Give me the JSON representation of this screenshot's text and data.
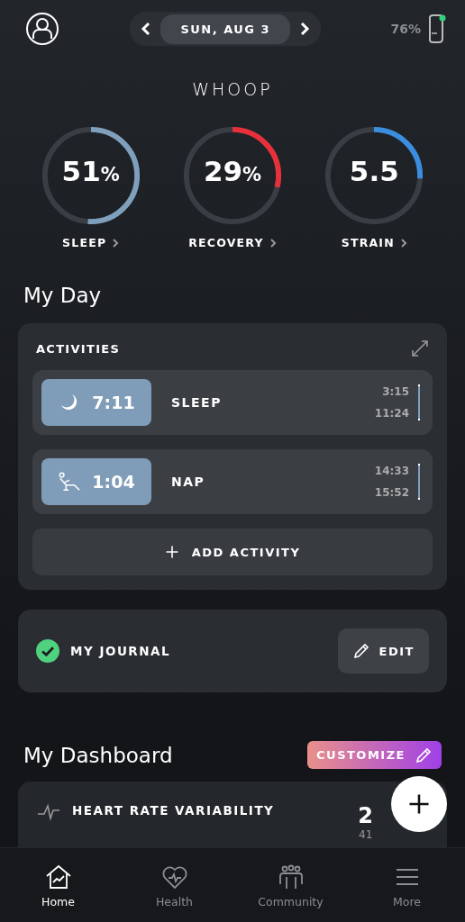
{
  "header": {
    "date": "SUN, AUG 3",
    "battery": "76%",
    "logo": "WHOOP"
  },
  "rings": [
    {
      "kind": "percent",
      "value": "51",
      "unit": "%",
      "label": "SLEEP",
      "level": 0.51,
      "color": "#7fa0bd"
    },
    {
      "kind": "percent",
      "value": "29",
      "unit": "%",
      "label": "RECOVERY",
      "level": 0.29,
      "color": "#e8303a"
    },
    {
      "kind": "score",
      "value": "5.5",
      "label": "STRAIN",
      "level": 0.26,
      "color": "#3b8de0"
    }
  ],
  "my_day": {
    "title": "My Day"
  },
  "activities": {
    "title": "ACTIVITIES",
    "items": [
      {
        "kind": "sleep",
        "duration": "7:11",
        "name": "SLEEP",
        "start": "3:15",
        "end": "11:24"
      },
      {
        "kind": "nap",
        "duration": "1:04",
        "name": "NAP",
        "start": "14:33",
        "end": "15:52"
      }
    ],
    "add_button": "ADD ACTIVITY"
  },
  "journal": {
    "label": "MY JOURNAL",
    "checked": true,
    "edit_button": "EDIT"
  },
  "dashboard": {
    "title": "My Dashboard",
    "customize_button": "CUSTOMIZE",
    "hrv": {
      "title": "HEART RATE VARIABILITY",
      "value": "2",
      "sub": "41"
    }
  },
  "nav": [
    {
      "label": "Home",
      "kind": "home",
      "selected": true
    },
    {
      "label": "Health",
      "kind": "health",
      "selected": false
    },
    {
      "label": "Community",
      "kind": "community",
      "selected": false
    },
    {
      "label": "More",
      "kind": "more",
      "selected": false
    }
  ]
}
